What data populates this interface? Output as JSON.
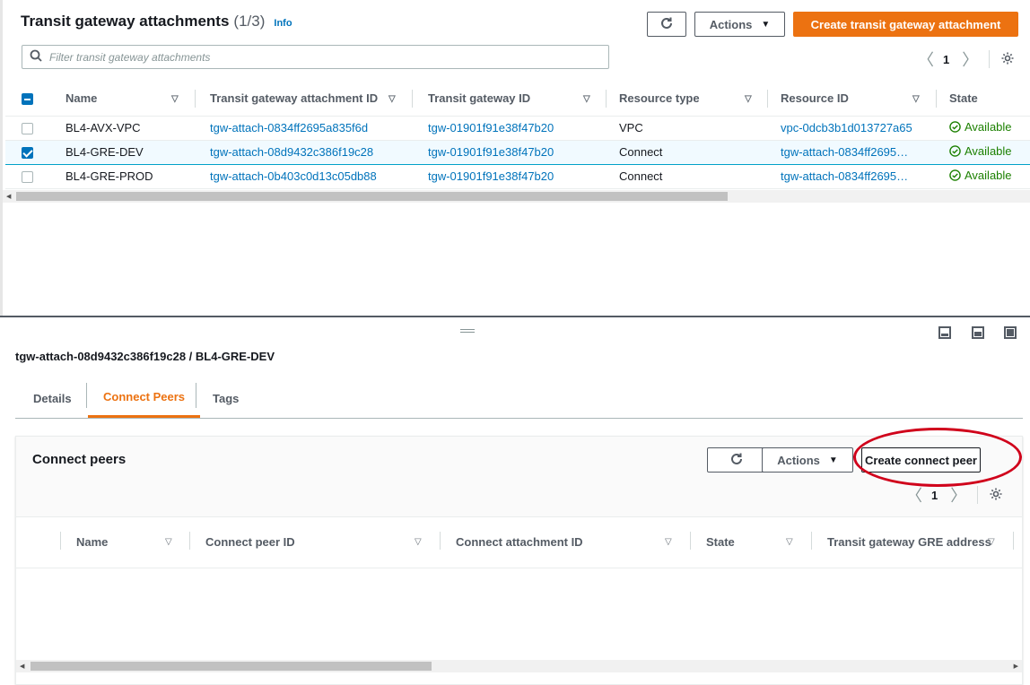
{
  "top": {
    "title": "Transit gateway attachments",
    "count": "(1/3)",
    "info": "Info",
    "actions_label": "Actions",
    "create_label": "Create transit gateway attachment",
    "filter_placeholder": "Filter transit gateway attachments",
    "page": "1",
    "columns": [
      "Name",
      "Transit gateway attachment ID",
      "Transit gateway ID",
      "Resource type",
      "Resource ID",
      "State"
    ],
    "rows": [
      {
        "selected": false,
        "name": "BL4-AVX-VPC",
        "attachment_id": "tgw-attach-0834ff2695a835f6d",
        "tgw_id": "tgw-01901f91e38f47b20",
        "resource_type": "VPC",
        "resource_id": "vpc-0dcb3b1d013727a65",
        "state": "Available"
      },
      {
        "selected": true,
        "name": "BL4-GRE-DEV",
        "attachment_id": "tgw-attach-08d9432c386f19c28",
        "tgw_id": "tgw-01901f91e38f47b20",
        "resource_type": "Connect",
        "resource_id": "tgw-attach-0834ff2695…",
        "state": "Available"
      },
      {
        "selected": false,
        "name": "BL4-GRE-PROD",
        "attachment_id": "tgw-attach-0b403c0d13c05db88",
        "tgw_id": "tgw-01901f91e38f47b20",
        "resource_type": "Connect",
        "resource_id": "tgw-attach-0834ff2695…",
        "state": "Available"
      }
    ]
  },
  "bottom": {
    "title": "tgw-attach-08d9432c386f19c28 / BL4-GRE-DEV",
    "tabs": [
      "Details",
      "Connect Peers",
      "Tags"
    ],
    "active_tab": "Connect Peers",
    "peers_title": "Connect peers",
    "actions_label": "Actions",
    "create_label": "Create connect peer",
    "page": "1",
    "columns": [
      "Name",
      "Connect peer ID",
      "Connect attachment ID",
      "State",
      "Transit gateway GRE address"
    ]
  },
  "colors": {
    "primary": "#ec7211",
    "link": "#0073bb",
    "success": "#1d8102",
    "selected_row": "#f1faff",
    "highlight_circle": "#d0021b"
  }
}
